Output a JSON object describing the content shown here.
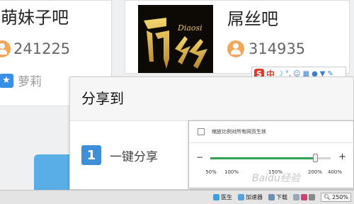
{
  "left_card": {
    "title": "萌妹子吧",
    "member_count": "241225",
    "username": "萝莉"
  },
  "right_card": {
    "title": "屌丝吧",
    "member_count": "314935",
    "logo_text": "Diaosi"
  },
  "ime_toolbar": {
    "logo": "S",
    "mode": "中",
    "icons": [
      "moon-icon",
      "comma-icon",
      "smile-icon",
      "keyboard-icon",
      "user-icon",
      "shirt-icon",
      "wrench-icon"
    ]
  },
  "share_popup": {
    "title": "分享到",
    "one_click_label": "一键分享",
    "one_click_icon": "1"
  },
  "zoom_panel": {
    "checkbox_label": "缩放比例对所有网页生效",
    "checked": false,
    "minus": "−",
    "plus": "+",
    "tick_labels": [
      "50%",
      "100%",
      "150%",
      "200%",
      "400%"
    ],
    "current_value": "250%",
    "slider_fraction": 0.87,
    "accent_color": "#2ea04f"
  },
  "status_bar": {
    "items": [
      "医生",
      "加速器",
      "下载"
    ],
    "zoom_display": "250%"
  },
  "watermark": "Baidu经验"
}
